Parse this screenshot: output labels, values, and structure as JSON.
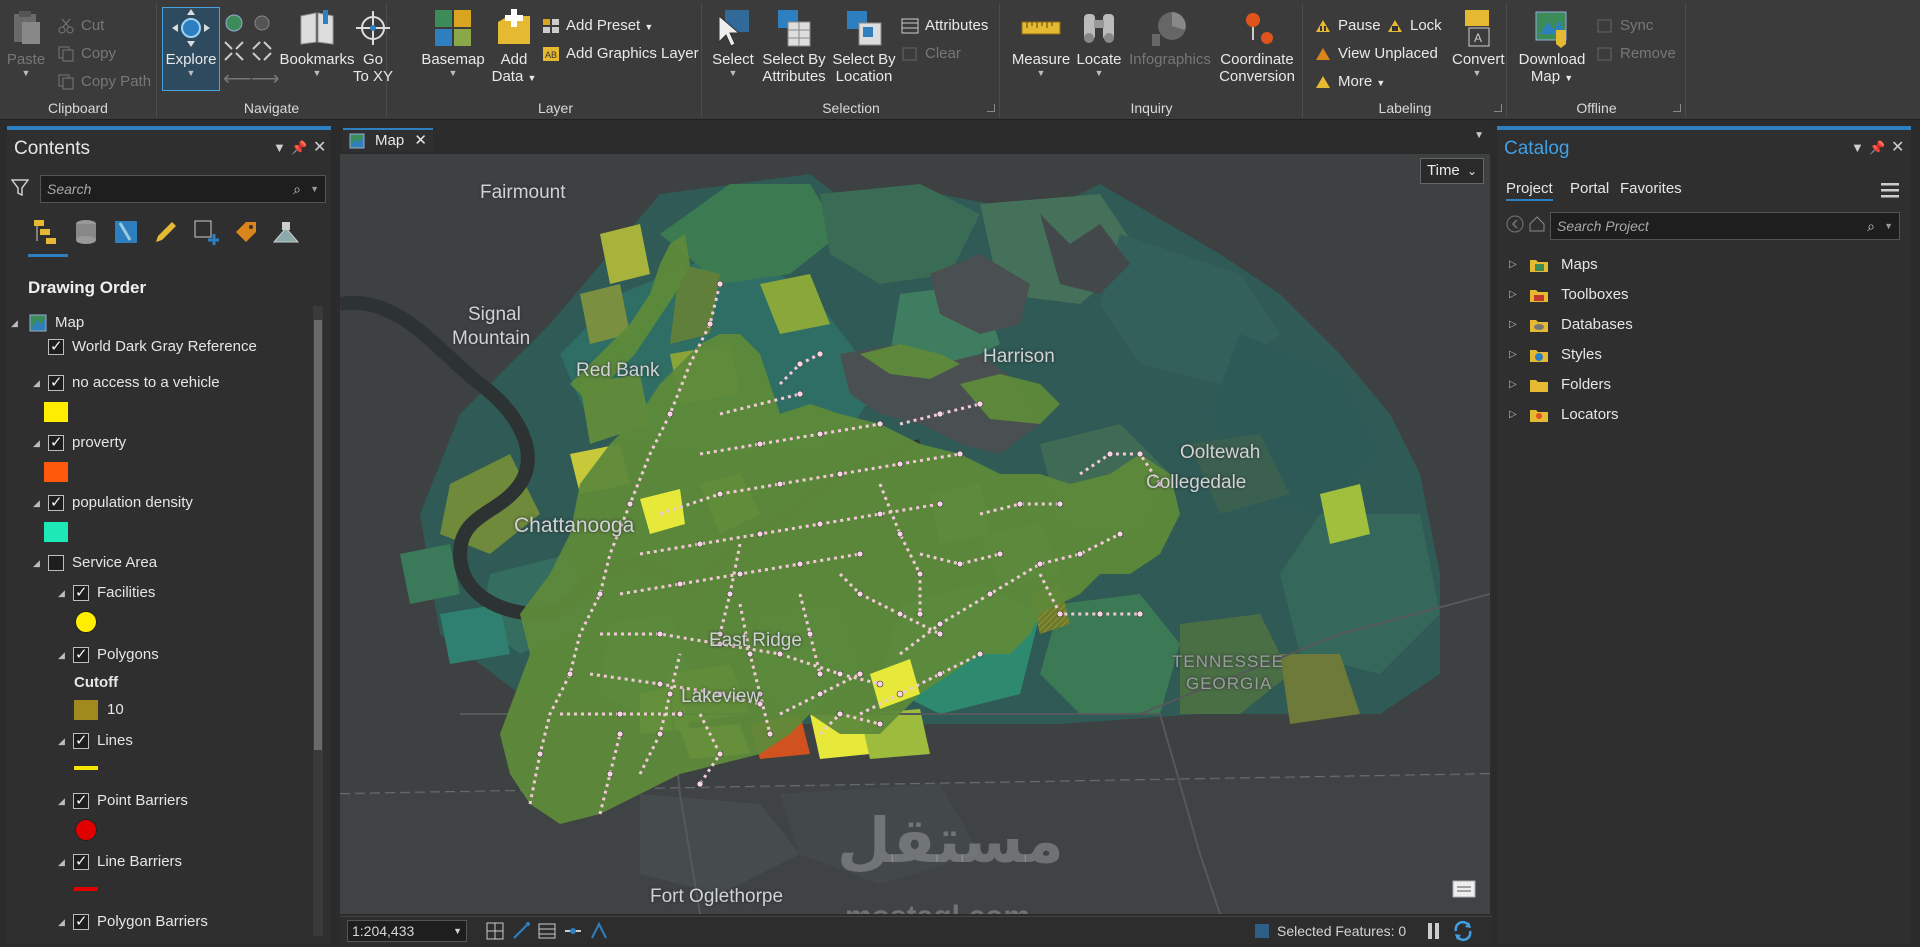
{
  "ribbon": {
    "clipboard": {
      "label": "Clipboard",
      "paste": "Paste",
      "cut": "Cut",
      "copy": "Copy",
      "copy_path": "Copy Path"
    },
    "navigate": {
      "label": "Navigate",
      "explore": "Explore",
      "bookmarks": "Bookmarks",
      "goto_xy_1": "Go",
      "goto_xy_2": "To XY"
    },
    "layer": {
      "label": "Layer",
      "basemap": "Basemap",
      "add_data_1": "Add",
      "add_data_2": "Data",
      "add_preset": "Add Preset",
      "add_graphics_layer": "Add Graphics Layer"
    },
    "selection": {
      "label": "Selection",
      "select": "Select",
      "sba_1": "Select By",
      "sba_2": "Attributes",
      "sbl_1": "Select By",
      "sbl_2": "Location",
      "attributes": "Attributes",
      "clear": "Clear"
    },
    "inquiry": {
      "label": "Inquiry",
      "measure": "Measure",
      "locate": "Locate",
      "infographics": "Infographics",
      "coord_1": "Coordinate",
      "coord_2": "Conversion"
    },
    "labeling": {
      "label": "Labeling",
      "pause": "Pause",
      "lock": "Lock",
      "view_unplaced": "View Unplaced",
      "more": "More",
      "convert": "Convert"
    },
    "offline": {
      "label": "Offline",
      "download_1": "Download",
      "download_2": "Map",
      "sync": "Sync",
      "remove": "Remove"
    }
  },
  "contents": {
    "title": "Contents",
    "search_placeholder": "Search",
    "drawing_order": "Drawing Order",
    "layers": {
      "map": "Map",
      "world_dark_gray": "World Dark Gray Reference",
      "no_access": "no access to a vehicle",
      "proverty": "proverty",
      "population_density": "population density",
      "service_area": "Service Area",
      "facilities": "Facilities",
      "polygons": "Polygons",
      "cutoff": "Cutoff",
      "cutoff_value": "10",
      "lines": "Lines",
      "point_barriers": "Point Barriers",
      "line_barriers": "Line Barriers",
      "polygon_barriers": "Polygon Barriers"
    },
    "colors": {
      "no_access": "#ffee00",
      "proverty": "#ff5a0a",
      "population_density": "#1de9b6",
      "facilities": "#ffee00",
      "cutoff": "#a08a1e",
      "lines": "#f2e600",
      "point_barriers": "#e00000",
      "line_barriers": "#e00000"
    }
  },
  "map": {
    "tab_label": "Map",
    "time_button": "Time",
    "scale": "1:204,433",
    "selected_features": "Selected Features: 0",
    "labels": {
      "fairmount": "Fairmount",
      "signal_1": "Signal",
      "signal_2": "Mountain",
      "red_bank": "Red Bank",
      "harrison": "Harrison",
      "ooltewah": "Ooltewah",
      "collegedale": "Collegedale",
      "chattanooga": "Chattanooga",
      "east_ridge": "East Ridge",
      "lakeview": "Lakeview",
      "fort_oglethorpe": "Fort Oglethorpe",
      "tennessee": "TENNESSEE",
      "georgia": "GEORGIA"
    },
    "watermark": {
      "arabic": "مستقل",
      "latin": "mostaql.com"
    }
  },
  "catalog": {
    "title": "Catalog",
    "tabs": [
      "Project",
      "Portal",
      "Favorites"
    ],
    "search_placeholder": "Search Project",
    "items": [
      "Maps",
      "Toolboxes",
      "Databases",
      "Styles",
      "Folders",
      "Locators"
    ]
  }
}
